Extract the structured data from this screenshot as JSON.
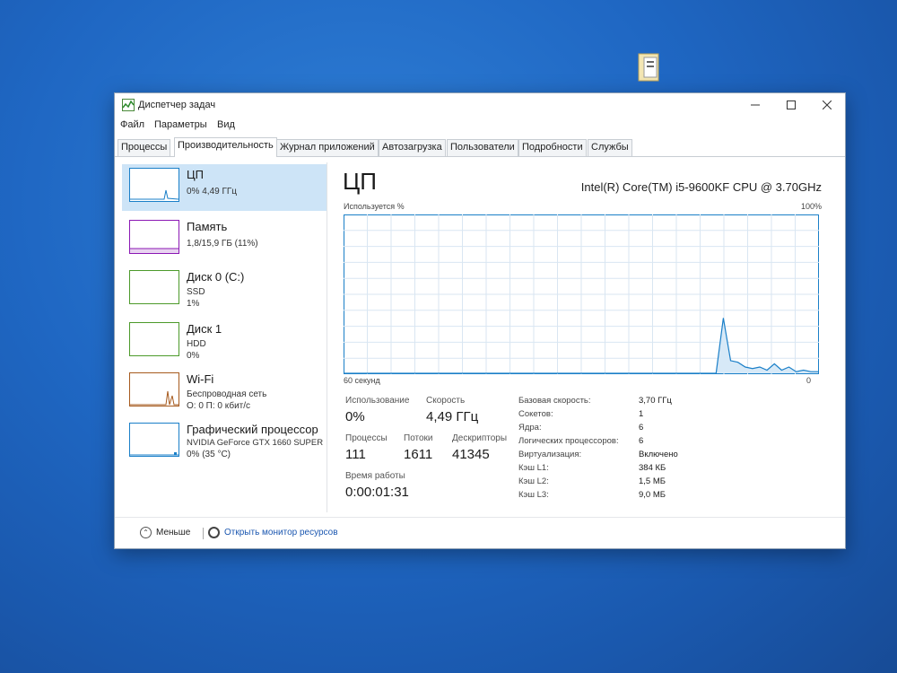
{
  "window": {
    "title": "Диспетчер задач"
  },
  "menu": [
    "Файл",
    "Параметры",
    "Вид"
  ],
  "tabs": [
    "Процессы",
    "Производительность",
    "Журнал приложений",
    "Автозагрузка",
    "Пользователи",
    "Подробности",
    "Службы"
  ],
  "active_tab": "Производительность",
  "sidebar": {
    "items": [
      {
        "name": "ЦП",
        "line1": "0% 4,49 ГГц",
        "line2": "",
        "color": "#1a7fc8"
      },
      {
        "name": "Память",
        "line1": "1,8/15,9 ГБ (11%)",
        "line2": "",
        "color": "#8b18b4"
      },
      {
        "name": "Диск 0 (C:)",
        "line1": "SSD",
        "line2": "1%",
        "color": "#4c9a2a"
      },
      {
        "name": "Диск 1",
        "line1": "HDD",
        "line2": "0%",
        "color": "#4c9a2a"
      },
      {
        "name": "Wi-Fi",
        "line1": "Беспроводная сеть",
        "line2": "О: 0 П: 0 кбит/с",
        "color": "#a65a1e"
      },
      {
        "name": "Графический процессор",
        "line1": "NVIDIA GeForce GTX 1660 SUPER",
        "line2": "0% (35 °C)",
        "color": "#1a7fc8"
      }
    ]
  },
  "cpu": {
    "title": "ЦП",
    "model": "Intel(R) Core(TM) i5-9600KF CPU @ 3.70GHz",
    "graph_label": "Используется %",
    "graph_max": "100%",
    "graph_time": "60 секунд",
    "graph_min": "0",
    "line_color": "#1a7fc8",
    "history": [
      0,
      0,
      0,
      0,
      0,
      0,
      0,
      0,
      0,
      0,
      0,
      0,
      0,
      0,
      0,
      0,
      0,
      0,
      0,
      0,
      0,
      0,
      0,
      0,
      0,
      0,
      0,
      0,
      0,
      0,
      0,
      0,
      0,
      0,
      0,
      0,
      0,
      0,
      0,
      0,
      0,
      0,
      0,
      0,
      0,
      0,
      0,
      0,
      0,
      0,
      0,
      0,
      35,
      8,
      7,
      4,
      3,
      4,
      2,
      6,
      2,
      4,
      1,
      2,
      1,
      1
    ]
  },
  "stats": {
    "utilization_label": "Использование",
    "utilization": "0%",
    "speed_label": "Скорость",
    "speed": "4,49 ГГц",
    "processes_label": "Процессы",
    "processes": "111",
    "threads_label": "Потоки",
    "threads": "1611",
    "handles_label": "Дескрипторы",
    "handles": "41345",
    "uptime_label": "Время работы",
    "uptime": "0:00:01:31"
  },
  "specs": [
    {
      "label": "Базовая скорость:",
      "value": "3,70 ГГц"
    },
    {
      "label": "Сокетов:",
      "value": "1"
    },
    {
      "label": "Ядра:",
      "value": "6"
    },
    {
      "label": "Логических процессоров:",
      "value": "6"
    },
    {
      "label": "Виртуализация:",
      "value": "Включено"
    },
    {
      "label": "Кэш L1:",
      "value": "384 КБ"
    },
    {
      "label": "Кэш L2:",
      "value": "1,5 МБ"
    },
    {
      "label": "Кэш L3:",
      "value": "9,0 МБ"
    }
  ],
  "footer": {
    "less": "Меньше",
    "monitor": "Открыть монитор ресурсов"
  }
}
